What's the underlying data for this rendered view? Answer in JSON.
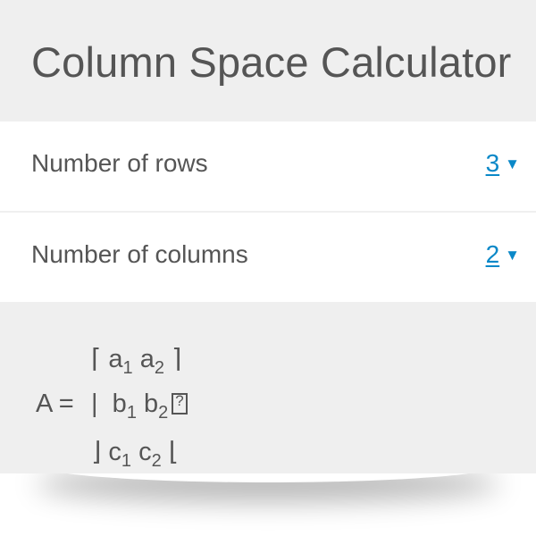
{
  "title": "Column Space Calculator",
  "fields": [
    {
      "label": "Number of rows",
      "value": "3",
      "arrow": "▼"
    },
    {
      "label": "Number of columns",
      "value": "2",
      "arrow": "▼"
    }
  ],
  "matrix": {
    "lhs": "A =",
    "row1": {
      "open": "⌈",
      "e1": "a",
      "s1": "1",
      "e2": "a",
      "s2": "2",
      "close": "⌉"
    },
    "row2": {
      "open": "|",
      "e1": "b",
      "s1": "1",
      "e2": "b",
      "s2": "2"
    },
    "row3": {
      "open": "⌋",
      "e1": "c",
      "s1": "1",
      "e2": "c",
      "s2": "2",
      "close": "⌊"
    }
  },
  "colors": {
    "accent": "#0a88c8",
    "text": "#555555",
    "panel": "#efefef"
  }
}
